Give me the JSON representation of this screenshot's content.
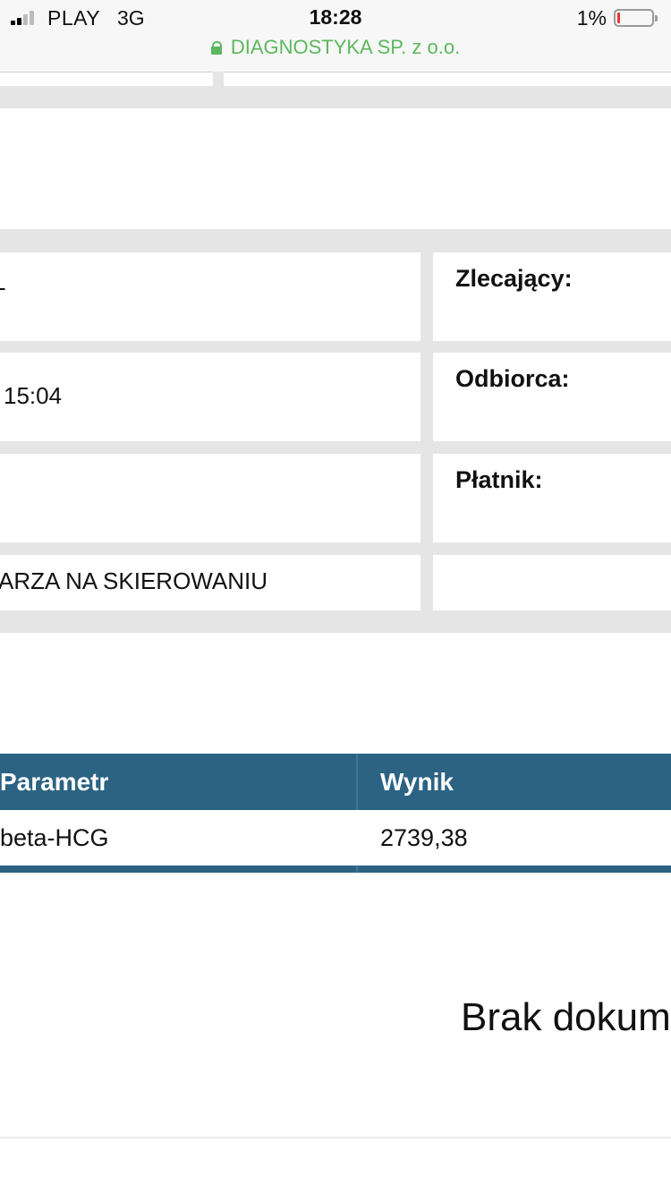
{
  "status_bar": {
    "carrier": "PLAY",
    "network": "3G",
    "time": "18:28",
    "battery_percent": "1%",
    "site_label": "DIAGNOSTYKA SP. z o.o."
  },
  "icons": {
    "signal": "signal-strength-icon",
    "lock": "lock-icon",
    "battery": "battery-icon"
  },
  "info_grid": {
    "left_col": [
      "-",
      "15:04",
      "",
      "ARZA NA SKIEROWANIU"
    ],
    "right_col_labels": [
      "Zlecający:",
      "Odbiorca:",
      "Płatnik:",
      ""
    ]
  },
  "results_table": {
    "headers": [
      "Parametr",
      "Wynik"
    ],
    "rows": [
      [
        "beta-HCG",
        "2739,38"
      ]
    ]
  },
  "documents": {
    "message": "Brak dokum"
  },
  "colors": {
    "table_header": "#2c6382",
    "secure_text": "#5cb85c",
    "page_gray": "#e5e5e5",
    "battery_low": "#e33333"
  }
}
